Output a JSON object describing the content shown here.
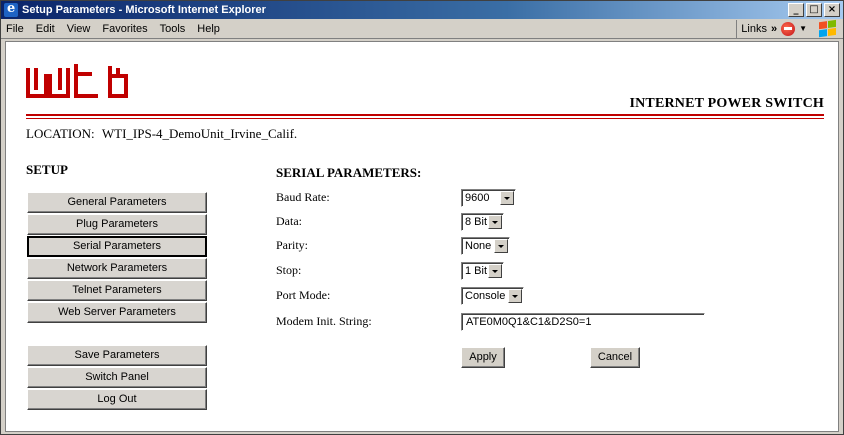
{
  "window": {
    "title": "Setup Parameters - Microsoft Internet Explorer",
    "controls": [
      "_",
      "□",
      "×"
    ]
  },
  "menubar": {
    "items": [
      "File",
      "Edit",
      "View",
      "Favorites",
      "Tools",
      "Help"
    ],
    "links_label": "Links",
    "links_chevron": "»"
  },
  "header": {
    "brand": "INTERNET POWER SWITCH",
    "logo_text": "wti",
    "location_label": "LOCATION:",
    "location_value": "WTI_IPS-4_DemoUnit_Irvine_Calif."
  },
  "sidebar": {
    "heading": "SETUP",
    "items": [
      {
        "label": "General Parameters"
      },
      {
        "label": "Plug Parameters"
      },
      {
        "label": "Serial Parameters",
        "active": true
      },
      {
        "label": "Network Parameters"
      },
      {
        "label": "Telnet Parameters"
      },
      {
        "label": "Web Server Parameters"
      }
    ],
    "actions": [
      {
        "label": "Save Parameters"
      },
      {
        "label": "Switch Panel"
      },
      {
        "label": "Log Out"
      }
    ]
  },
  "form": {
    "heading": "SERIAL PARAMETERS:",
    "baud_rate": {
      "label": "Baud Rate:",
      "value": "9600"
    },
    "data": {
      "label": "Data:",
      "value": "8 Bit"
    },
    "parity": {
      "label": "Parity:",
      "value": "None"
    },
    "stop": {
      "label": "Stop:",
      "value": "1 Bit"
    },
    "port_mode": {
      "label": "Port Mode:",
      "value": "Console"
    },
    "modem_init": {
      "label": "Modem Init. String:",
      "value": "ATE0M0Q1&C1&D2S0=1"
    },
    "apply_label": "Apply",
    "cancel_label": "Cancel"
  },
  "colors": {
    "titlebar_start": "#0a246a",
    "accent_red": "#c00000",
    "face": "#d4d0c8"
  }
}
